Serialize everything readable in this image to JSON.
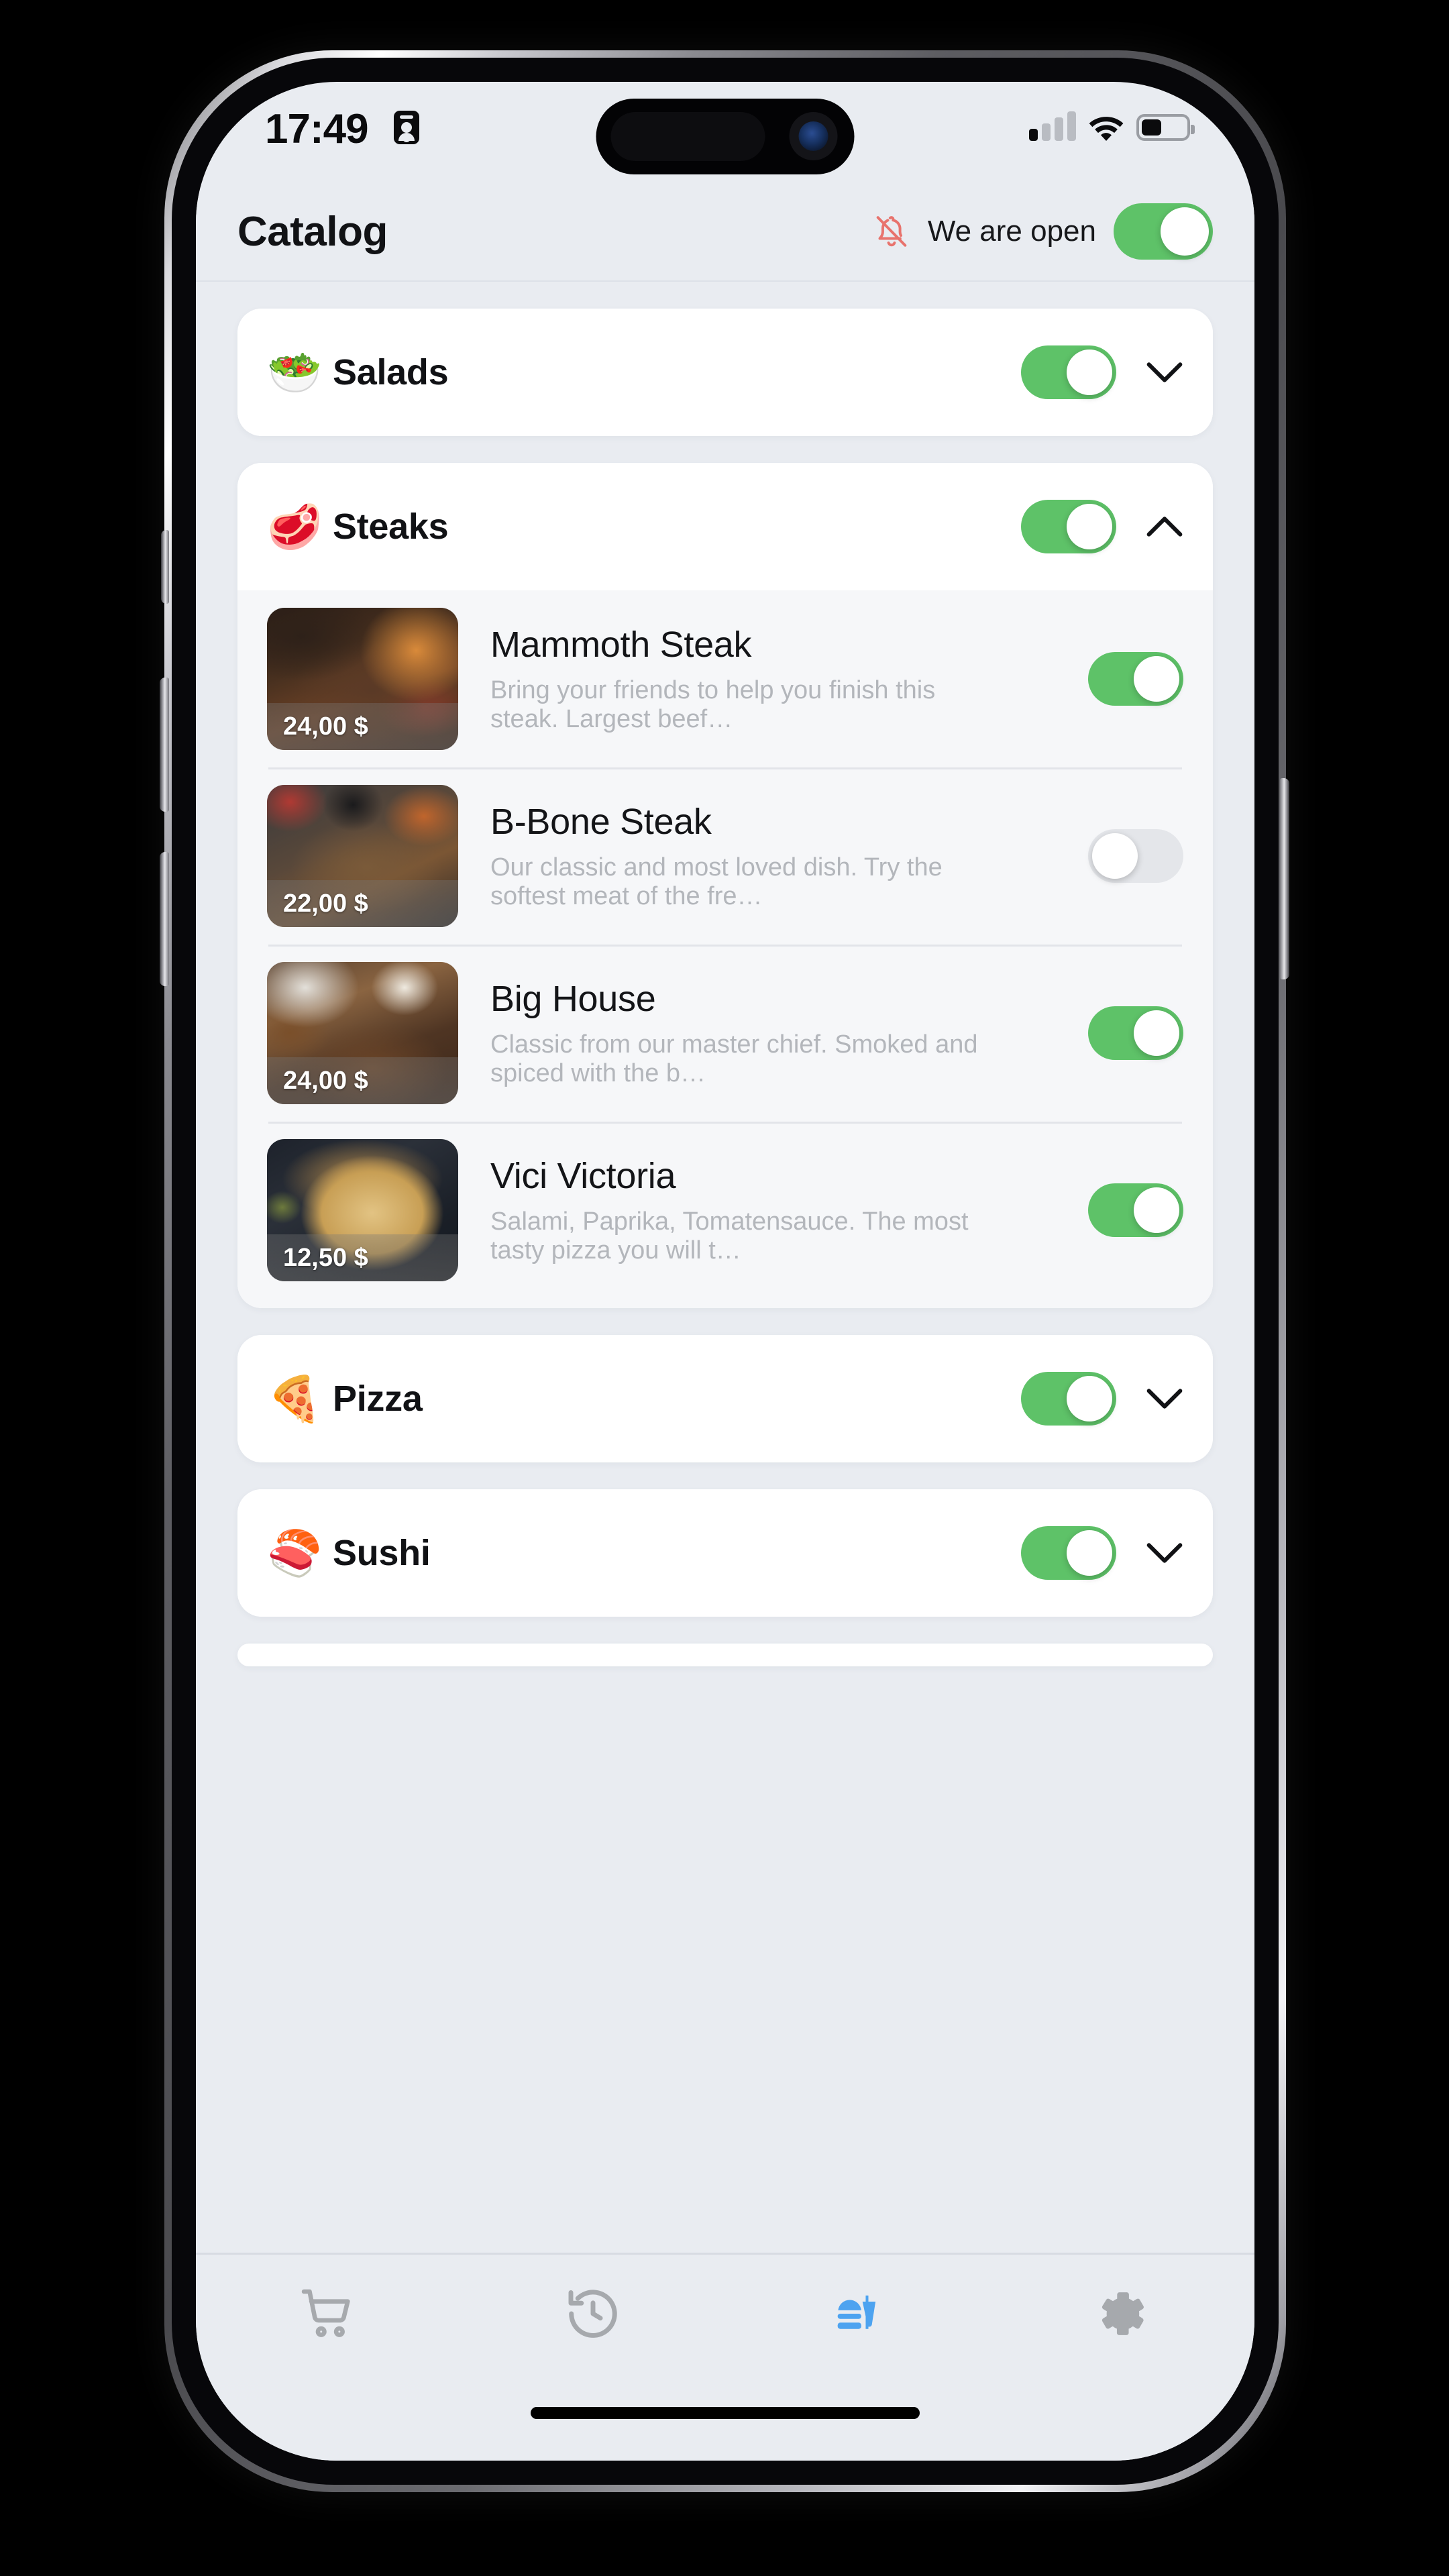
{
  "status_bar": {
    "time": "17:49",
    "left_icon": "id-card-icon",
    "signal_icon": "cellular-signal-icon",
    "signal_bars_filled": 1,
    "signal_bars_total": 4,
    "wifi_icon": "wifi-icon",
    "battery_icon": "battery-icon",
    "battery_level_percent": 45
  },
  "header": {
    "title": "Catalog",
    "bell_icon": "bell-off-icon",
    "status_label": "We are open",
    "status_toggle_on": true,
    "bell_color": "#e8736d",
    "toggle_on_color": "#5ec268",
    "toggle_off_color": "#e4e6ea"
  },
  "categories": [
    {
      "name": "Salads",
      "emoji": "🥗",
      "emoji_name": "salad-emoji",
      "enabled": true,
      "expanded": false,
      "chevron": "chevron-down-icon",
      "items": []
    },
    {
      "name": "Steaks",
      "emoji": "🥩",
      "emoji_name": "steak-emoji",
      "enabled": true,
      "expanded": true,
      "chevron": "chevron-up-icon",
      "items": [
        {
          "name": "Mammoth Steak",
          "description": "Bring your friends to help you finish this steak. Largest beef…",
          "price": "24,00 $",
          "enabled": true,
          "image_desc": "grilled-steak-with-carrots"
        },
        {
          "name": "B-Bone Steak",
          "description": "Our classic and most loved dish. Try the softest meat of the fre…",
          "price": "22,00 $",
          "enabled": false,
          "image_desc": "t-bone-steak-on-board"
        },
        {
          "name": "Big House",
          "description": "Classic from our master chief. Smoked and spiced with the b…",
          "price": "24,00 $",
          "enabled": true,
          "image_desc": "salted-steak-closeup"
        },
        {
          "name": "Vici Victoria",
          "description": "Salami, Paprika, Tomatensauce. The most tasty pizza you will t…",
          "price": "12,50 $",
          "enabled": true,
          "image_desc": "sliced-pizza-on-board"
        }
      ]
    },
    {
      "name": "Pizza",
      "emoji": "🍕",
      "emoji_name": "pizza-emoji",
      "enabled": true,
      "expanded": false,
      "chevron": "chevron-down-icon",
      "items": []
    },
    {
      "name": "Sushi",
      "emoji": "🍣",
      "emoji_name": "sushi-emoji",
      "enabled": true,
      "expanded": false,
      "chevron": "chevron-down-icon",
      "items": []
    }
  ],
  "tabbar": {
    "active_index": 2,
    "active_color": "#4da3f0",
    "inactive_color": "#a6a9ad",
    "tabs": [
      {
        "icon": "shopping-cart-icon",
        "active": false
      },
      {
        "icon": "history-clock-icon",
        "active": false
      },
      {
        "icon": "fast-food-icon",
        "active": true
      },
      {
        "icon": "gear-icon",
        "active": false
      }
    ]
  }
}
